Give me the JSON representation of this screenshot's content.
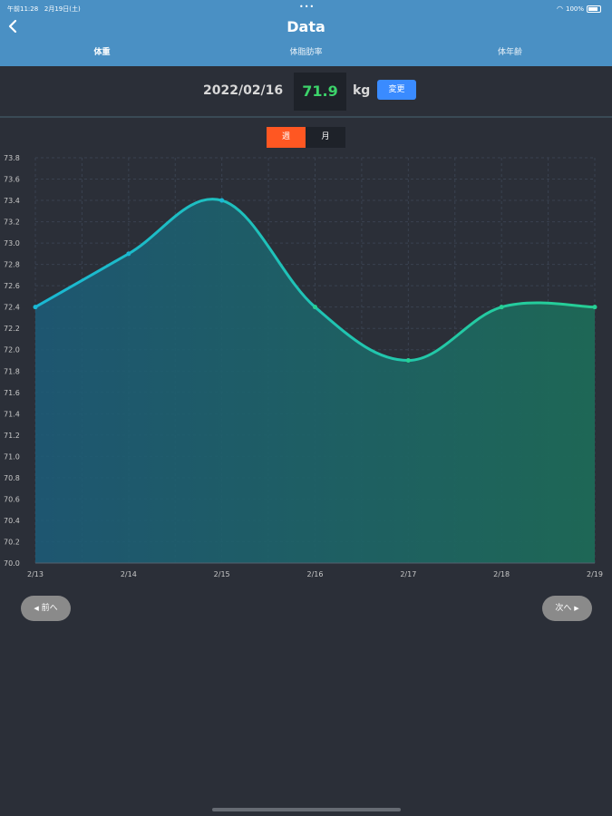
{
  "status_bar": {
    "time": "午前11:28",
    "date": "2月19日(土)",
    "battery": "100%"
  },
  "header": {
    "title": "Data",
    "back_icon": "chevron-left-icon"
  },
  "tabs": [
    {
      "label": "体重"
    },
    {
      "label": "体脂肪率"
    },
    {
      "label": "体年齢"
    }
  ],
  "record": {
    "date": "2022/02/16",
    "value": "71.9",
    "unit": "kg",
    "change_label": "変更"
  },
  "period": {
    "week_label": "週",
    "month_label": "月"
  },
  "colors": {
    "accent": "#ff5722",
    "header": "#4a90c4",
    "value": "#3cd36a",
    "line_start": "#1ab8d4",
    "line_end": "#26cf95"
  },
  "chart_data": {
    "type": "area",
    "categories": [
      "2/13",
      "2/14",
      "2/15",
      "2/16",
      "2/17",
      "2/18",
      "2/19"
    ],
    "values": [
      72.4,
      72.9,
      73.4,
      72.4,
      71.9,
      72.4,
      72.4
    ],
    "ylim": [
      70.0,
      73.8
    ],
    "yticks": [
      "70.0",
      "70.2",
      "70.4",
      "70.6",
      "70.8",
      "71.0",
      "71.2",
      "71.4",
      "71.6",
      "71.8",
      "72.0",
      "72.2",
      "72.4",
      "72.6",
      "72.8",
      "73.0",
      "73.2",
      "73.4",
      "73.6",
      "73.8"
    ],
    "grid": true
  },
  "nav": {
    "prev_label": "前へ",
    "next_label": "次へ"
  }
}
